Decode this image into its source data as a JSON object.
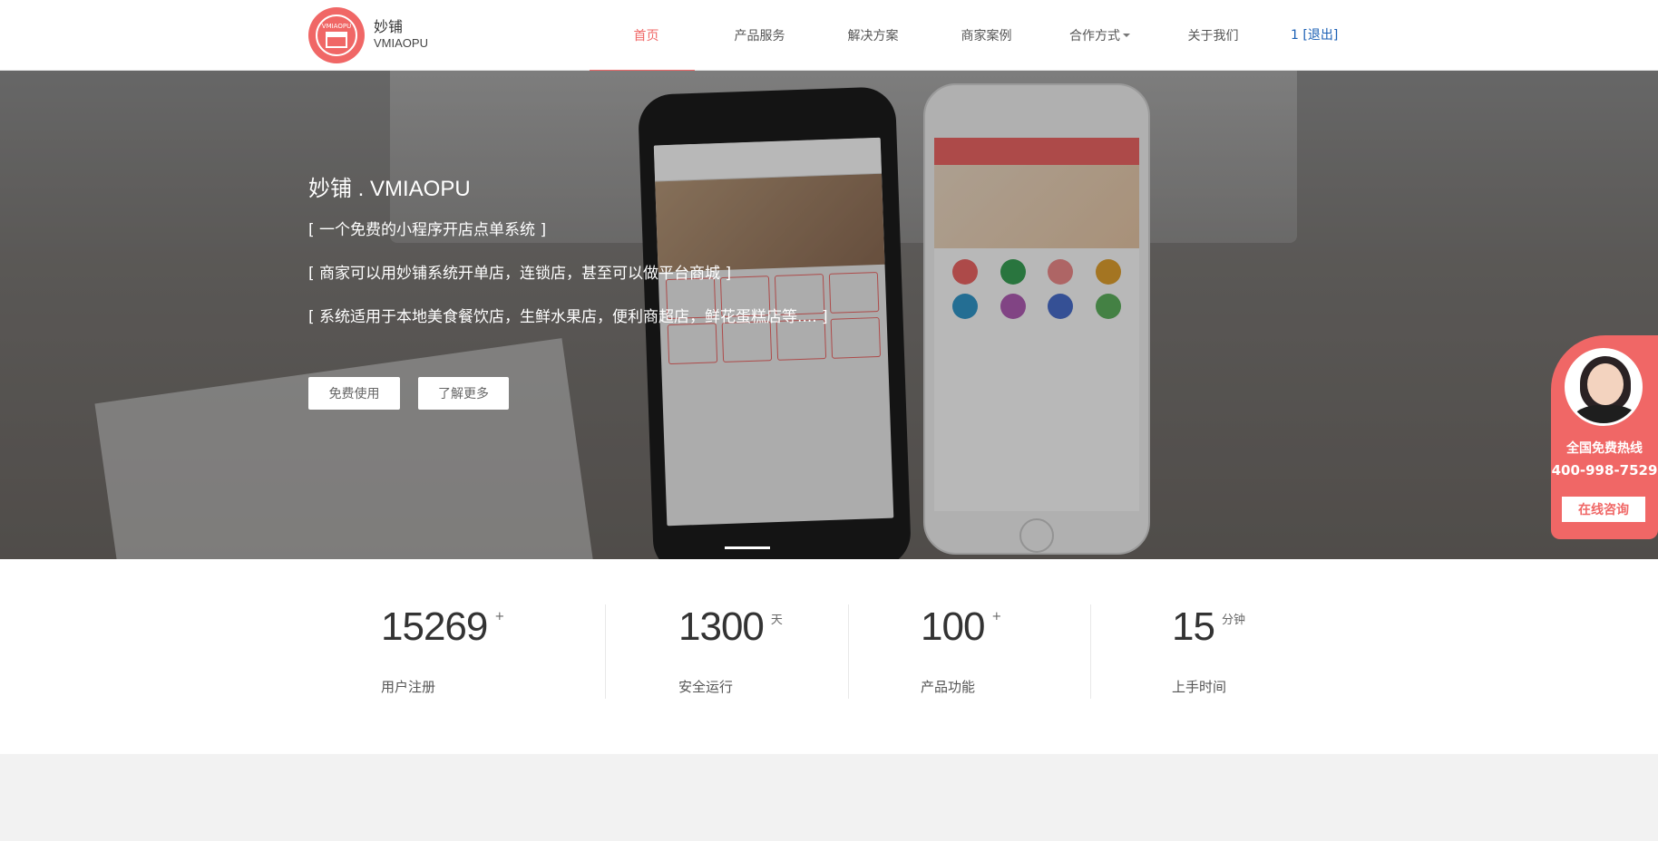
{
  "header": {
    "brand_cn": "妙铺",
    "brand_en": "VMIAOPU",
    "logo_text": "VMIAOPU",
    "nav": [
      {
        "label": "首页",
        "active": true
      },
      {
        "label": "产品服务"
      },
      {
        "label": "解决方案"
      },
      {
        "label": "商家案例"
      },
      {
        "label": "合作方式",
        "dropdown": true
      },
      {
        "label": "关于我们"
      }
    ],
    "user_id": "1",
    "logout": "退出"
  },
  "hero": {
    "title": "妙铺 . VMIAOPU",
    "lines": [
      "[ 一个免费的小程序开店点单系统 ]",
      "[ 商家可以用妙铺系统开单店，连锁店，甚至可以做平台商城 ]",
      "[ 系统适用于本地美食餐饮店，生鲜水果店，便利商超店，鲜花蛋糕店等.... ]"
    ],
    "btn_free": "免费使用",
    "btn_more": "了解更多"
  },
  "float_widget": {
    "hotline_label": "全国免费热线",
    "phone": "400-998-7529",
    "consult": "在线咨询"
  },
  "stats": [
    {
      "value": "15269",
      "unit": "+",
      "label": "用户注册"
    },
    {
      "value": "1300",
      "unit": "天",
      "label": "安全运行"
    },
    {
      "value": "100",
      "unit": "+",
      "label": "产品功能"
    },
    {
      "value": "15",
      "unit": "分钟",
      "label": "上手时间"
    }
  ],
  "colors": {
    "accent": "#f06766",
    "link": "#1a5fb4"
  }
}
